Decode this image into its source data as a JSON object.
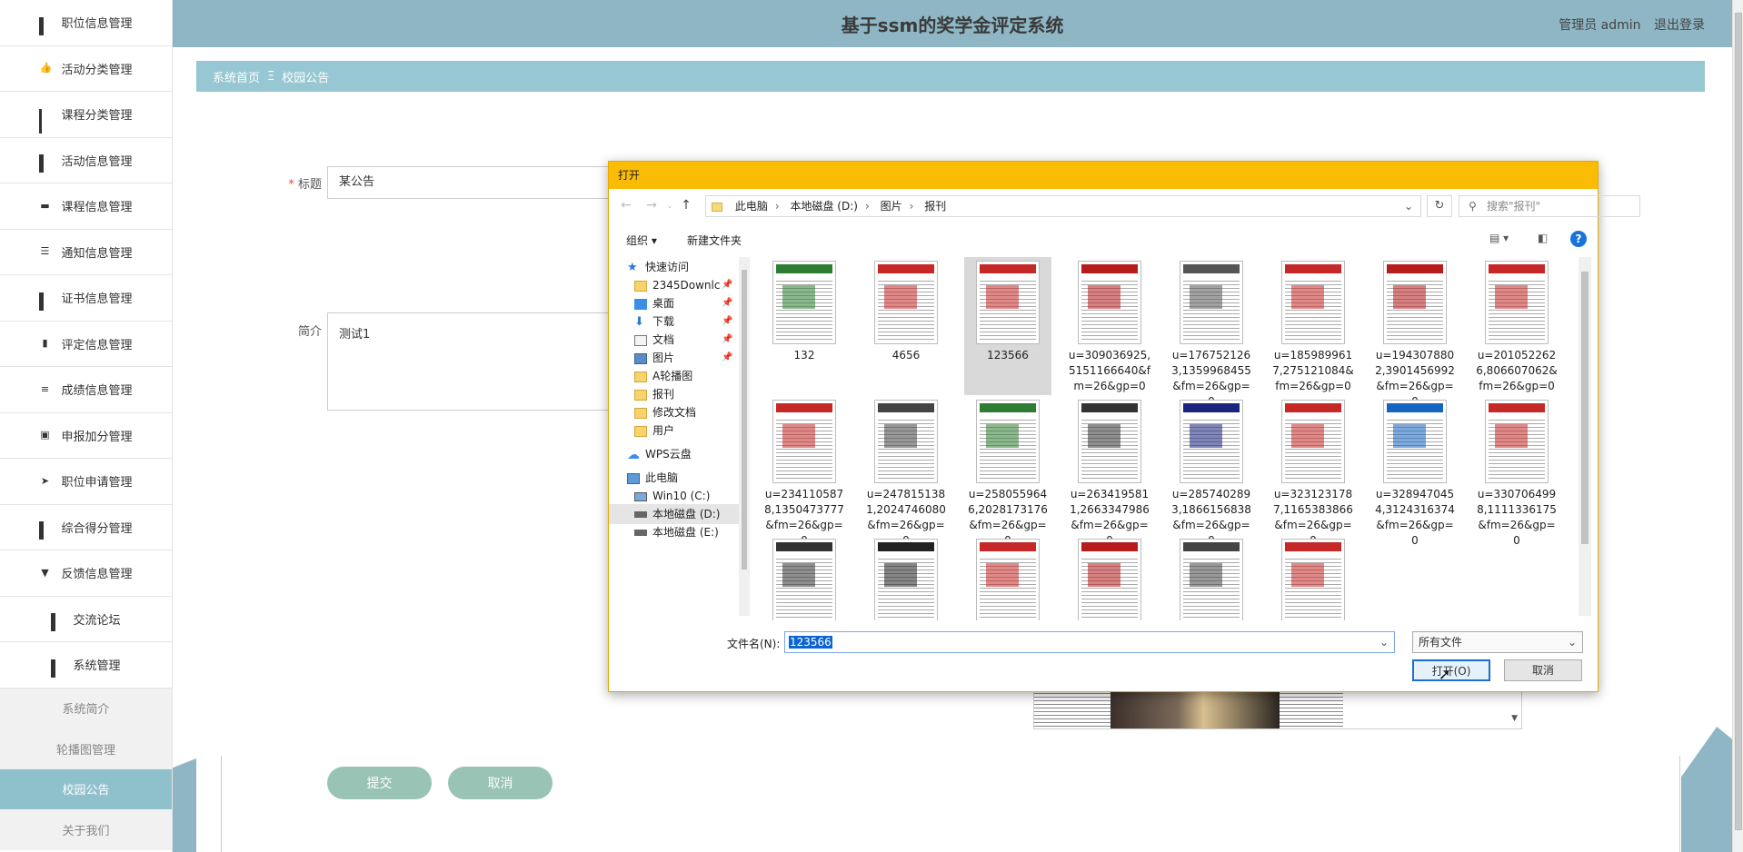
{
  "app_title": "基于ssm的奖学金评定系统",
  "user": {
    "greeting": "管理员 admin",
    "logout": "退出登录"
  },
  "sidebar": {
    "items": [
      {
        "label": "职位信息管理",
        "icon": "grid-icon"
      },
      {
        "label": "活动分类管理",
        "icon": "thumbs-up-icon"
      },
      {
        "label": "课程分类管理",
        "icon": "grid9-icon"
      },
      {
        "label": "活动信息管理",
        "icon": "grid-icon"
      },
      {
        "label": "课程信息管理",
        "icon": "bus-icon"
      },
      {
        "label": "通知信息管理",
        "icon": "sliders-icon"
      },
      {
        "label": "证书信息管理",
        "icon": "grid-icon"
      },
      {
        "label": "评定信息管理",
        "icon": "bar-chart-icon"
      },
      {
        "label": "成绩信息管理",
        "icon": "list-icon"
      },
      {
        "label": "申报加分管理",
        "icon": "clipboard-icon"
      },
      {
        "label": "职位申请管理",
        "icon": "send-icon"
      },
      {
        "label": "综合得分管理",
        "icon": "grid-icon"
      },
      {
        "label": "反馈信息管理",
        "icon": "pin-icon"
      },
      {
        "label": "交流论坛",
        "icon": "grid-icon"
      },
      {
        "label": "系统管理",
        "icon": "grid-icon"
      }
    ],
    "sub_items": [
      {
        "label": "系统简介"
      },
      {
        "label": "轮播图管理"
      },
      {
        "label": "校园公告",
        "active": true
      },
      {
        "label": "关于我们"
      }
    ]
  },
  "breadcrumb": {
    "home": "系统首页",
    "sep": "Ξ",
    "current": "校园公告"
  },
  "form": {
    "title_label": "标题",
    "title_required": "*",
    "title_value": "某公告",
    "intro_label": "简介",
    "intro_value": "测试1",
    "submit": "提交",
    "cancel": "取消"
  },
  "dialog": {
    "title": "打开",
    "path": [
      "此电脑",
      "本地磁盘 (D:)",
      "图片",
      "报刊"
    ],
    "search_placeholder": "搜索\"报刊\"",
    "organize": "组织 ▾",
    "new_folder": "新建文件夹",
    "tree": [
      {
        "label": "快速访问",
        "icon": "star",
        "pinned": false
      },
      {
        "label": "2345Downlc",
        "icon": "folder",
        "pinned": true
      },
      {
        "label": "桌面",
        "icon": "desk",
        "pinned": true
      },
      {
        "label": "下载",
        "icon": "down",
        "pinned": true
      },
      {
        "label": "文档",
        "icon": "doc",
        "pinned": true
      },
      {
        "label": "图片",
        "icon": "pic",
        "pinned": true
      },
      {
        "label": "A轮播图",
        "icon": "folder",
        "pinned": false
      },
      {
        "label": "报刊",
        "icon": "folder",
        "pinned": false
      },
      {
        "label": "修改文档",
        "icon": "folder",
        "pinned": false
      },
      {
        "label": "用户",
        "icon": "folder",
        "pinned": false
      },
      {
        "label": "WPS云盘",
        "icon": "cloud",
        "pinned": false
      },
      {
        "label": "此电脑",
        "icon": "pc",
        "pinned": false
      },
      {
        "label": "Win10 (C:)",
        "icon": "win",
        "pinned": false
      },
      {
        "label": "本地磁盘 (D:)",
        "icon": "drive",
        "pinned": false,
        "selected": true
      },
      {
        "label": "本地磁盘 (E:)",
        "icon": "drive",
        "pinned": false
      }
    ],
    "files": [
      {
        "name": "132",
        "hd": "#2e7d32"
      },
      {
        "name": "4656",
        "hd": "#c62828"
      },
      {
        "name": "123566",
        "hd": "#c62828",
        "selected": true
      },
      {
        "name": "u=309036925,5151166640&fm=26&gp=0",
        "hd": "#b71c1c"
      },
      {
        "name": "u=1767521263,1359968455&fm=26&gp=0",
        "hd": "#555555"
      },
      {
        "name": "u=1859899617,275121084&fm=26&gp=0",
        "hd": "#c62828"
      },
      {
        "name": "u=1943078802,3901456992&fm=26&gp=0",
        "hd": "#b71c1c"
      },
      {
        "name": "u=2010522626,806607062&fm=26&gp=0",
        "hd": "#c62828"
      },
      {
        "name": "u=2341105878,1350473777&fm=26&gp=0",
        "hd": "#c62828"
      },
      {
        "name": "u=2478151381,2024746080&fm=26&gp=0",
        "hd": "#444444"
      },
      {
        "name": "u=2580559646,2028173176&fm=26&gp=0",
        "hd": "#2e7d32"
      },
      {
        "name": "u=2634195811,2663347986&fm=26&gp=0",
        "hd": "#333333"
      },
      {
        "name": "u=2857402893,1866156838&fm=26&gp=0",
        "hd": "#1a237e"
      },
      {
        "name": "u=3231231787,1165383866&fm=26&gp=0",
        "hd": "#c62828"
      },
      {
        "name": "u=3289470454,3124316374&fm=26&gp=0",
        "hd": "#1565c0"
      },
      {
        "name": "u=3307064998,1111336175&fm=26&gp=0",
        "hd": "#c62828"
      },
      {
        "name": "",
        "hd": "#333333"
      },
      {
        "name": "",
        "hd": "#222222"
      },
      {
        "name": "",
        "hd": "#c62828"
      },
      {
        "name": "",
        "hd": "#b71c1c"
      },
      {
        "name": "",
        "hd": "#444444"
      },
      {
        "name": "",
        "hd": "#c62828"
      }
    ],
    "filename_label": "文件名(N):",
    "filename_value": "123566",
    "filetype": "所有文件",
    "open": "打开(O)",
    "cancel": "取消"
  },
  "colors": {
    "header": "#8fb6c5",
    "breadcrumb": "#96c7d2",
    "dialog_title": "#fbbc05",
    "button": "#98c3b5",
    "active_sub": "#8fc1cc"
  }
}
